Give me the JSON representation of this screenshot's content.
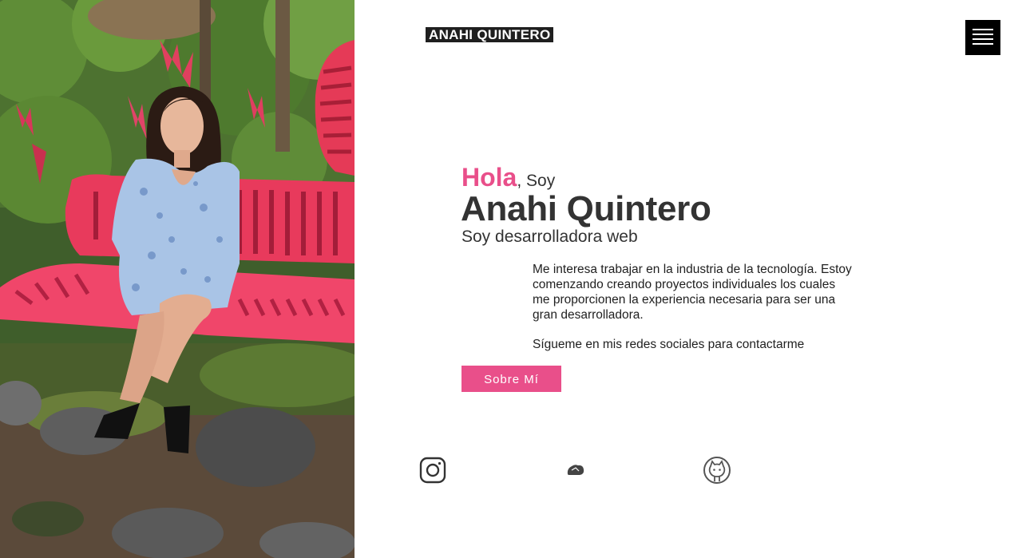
{
  "header": {
    "logo_text": "ANAHI QUINTERO",
    "menu_icon": "hamburger-menu-icon"
  },
  "hero": {
    "greeting_highlight": "Hola",
    "greeting_rest": ", Soy",
    "name": "Anahi Quintero",
    "role": "Soy desarrolladora web",
    "bio": "Me interesa trabajar en la industria de la tecnología. Estoy comenzando creando proyectos individuales los cuales me proporcionen la experiencia necesaria para ser una gran desarrolladora.",
    "follow_text": "Sígueme en mis redes sociales para contactarme",
    "about_button": "Sobre Mí"
  },
  "social": [
    {
      "icon": "instagram-icon"
    },
    {
      "icon": "platzi-icon"
    },
    {
      "icon": "github-icon"
    }
  ],
  "colors": {
    "accent": "#e94f8a",
    "text": "#333333",
    "logo_bg": "#1f1f1f",
    "menu_bg": "#000000"
  }
}
